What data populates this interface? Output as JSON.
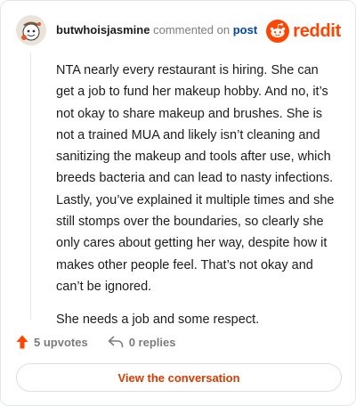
{
  "comment": {
    "username": "butwhoisjasmine",
    "action_text": "commented on",
    "post_link": "post",
    "paragraphs": [
      "NTA nearly every restaurant is hiring. She can get a job to fund her makeup hobby. And no, it’s not okay to share makeup and brushes. She is not a trained MUA and likely isn’t cleaning and sanitizing the makeup and tools after use, which breeds bacteria and can lead to nasty infections. Lastly, you’ve explained it multiple times and she still stomps over the boundaries, so clearly she only cares about getting her way, despite how it makes other people feel. That’s not okay and can’t be ignored.",
      "She needs a job and some respect."
    ]
  },
  "brand": {
    "wordmark": "reddit",
    "color": "#ff4500",
    "icon": "reddit-logo-icon"
  },
  "actions": {
    "upvotes": "5 upvotes",
    "replies": "0 replies",
    "upvote_icon": "upvote-arrow-icon",
    "reply_icon": "reply-arrow-icon"
  },
  "cta": {
    "label": "View the conversation"
  },
  "colors": {
    "accent": "#d93a00",
    "link": "#0045ac",
    "muted": "#7c7c7c",
    "text": "#1c1c1c"
  }
}
